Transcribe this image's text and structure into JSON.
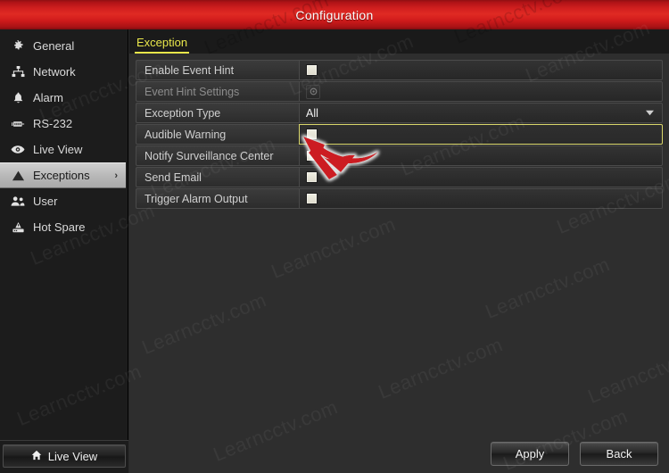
{
  "window": {
    "title": "Configuration",
    "titlebar_color": "#d3201f"
  },
  "sidebar": {
    "items": [
      {
        "label": "General",
        "icon": "gear-icon",
        "selected": false
      },
      {
        "label": "Network",
        "icon": "network-icon",
        "selected": false
      },
      {
        "label": "Alarm",
        "icon": "alarm-bell-icon",
        "selected": false
      },
      {
        "label": "RS-232",
        "icon": "serial-port-icon",
        "selected": false
      },
      {
        "label": "Live View",
        "icon": "eye-icon",
        "selected": false
      },
      {
        "label": "Exceptions",
        "icon": "warning-triangle-icon",
        "selected": true
      },
      {
        "label": "User",
        "icon": "users-icon",
        "selected": false
      },
      {
        "label": "Hot Spare",
        "icon": "hot-spare-icon",
        "selected": false
      }
    ],
    "footer_button": {
      "label": "Live View",
      "icon": "home-icon"
    },
    "selected_chevron": "›"
  },
  "main": {
    "tab": "Exception",
    "tab_color": "#e8e64a",
    "rows": [
      {
        "label": "Enable Event Hint",
        "control": "checkbox",
        "checked": false,
        "disabled": false,
        "focused": false
      },
      {
        "label": "Event Hint Settings",
        "control": "settings-button",
        "icon": "gear-icon",
        "disabled": true,
        "focused": false
      },
      {
        "label": "Exception Type",
        "control": "dropdown",
        "value": "All",
        "caret": "⌄",
        "disabled": false,
        "focused": false
      },
      {
        "label": "Audible Warning",
        "control": "checkbox",
        "checked": false,
        "disabled": false,
        "focused": true
      },
      {
        "label": "Notify Surveillance Center",
        "control": "checkbox",
        "checked": false,
        "disabled": false,
        "focused": false
      },
      {
        "label": "Send Email",
        "control": "checkbox",
        "checked": false,
        "disabled": false,
        "focused": false
      },
      {
        "label": "Trigger Alarm Output",
        "control": "checkbox",
        "checked": false,
        "disabled": false,
        "focused": false
      }
    ],
    "focus_border_color": "#d9d66a"
  },
  "actions": {
    "apply_label": "Apply",
    "back_label": "Back"
  },
  "annotation": {
    "arrow_color": "#cc1f20",
    "points_at": "Audible Warning checkbox"
  },
  "watermark": {
    "text": "Learncctv.com"
  }
}
